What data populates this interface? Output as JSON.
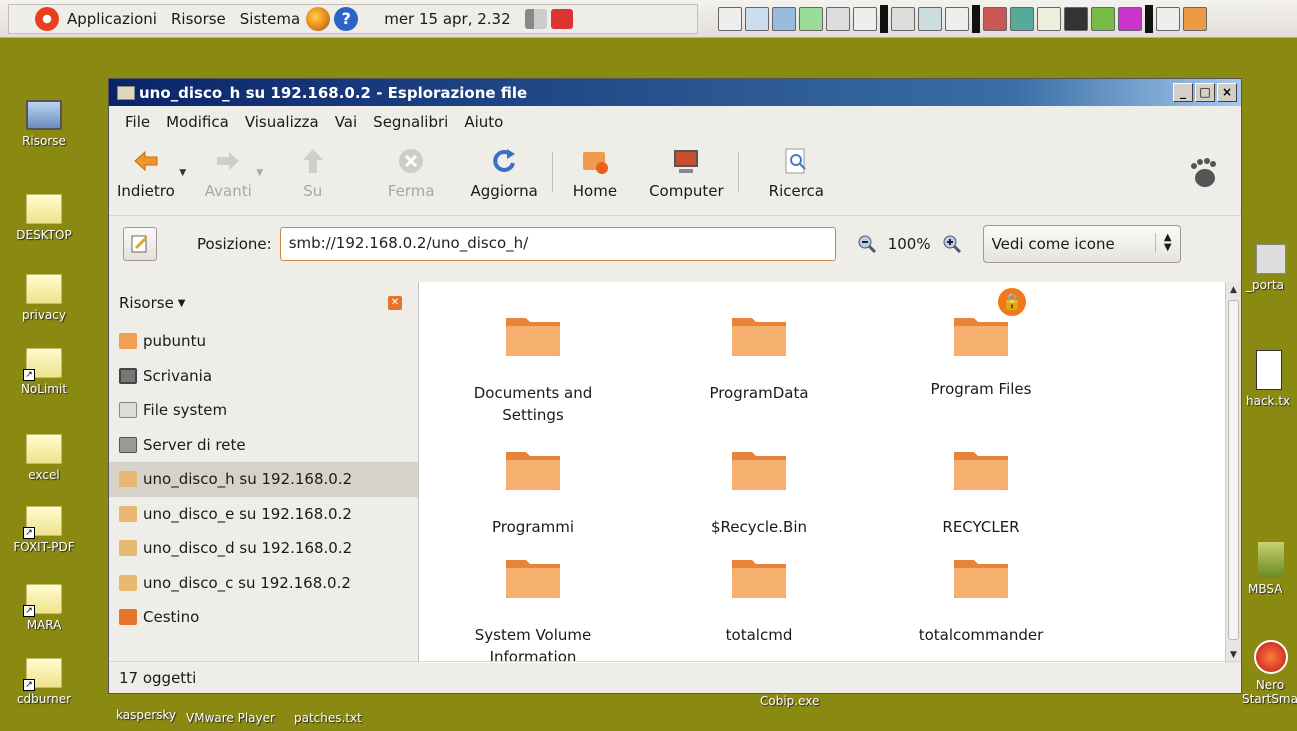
{
  "top_panel": {
    "menus": [
      "Applicazioni",
      "Risorse",
      "Sistema"
    ],
    "clock": "mer 15 apr,  2.32"
  },
  "desktop_left": [
    {
      "label": "Risorse",
      "icon": "computer-icon"
    },
    {
      "label": "DESKTOP",
      "icon": "folder-icon"
    },
    {
      "label": "privacy",
      "icon": "folder-icon"
    },
    {
      "label": "NoLimit",
      "icon": "folder-icon"
    },
    {
      "label": "excel",
      "icon": "folder-icon"
    },
    {
      "label": "FOXIT-PDF",
      "icon": "folder-icon"
    },
    {
      "label": "MARA",
      "icon": "folder-icon"
    },
    {
      "label": "cdburner",
      "icon": "folder-icon"
    }
  ],
  "desktop_right": [
    {
      "label": "_porta"
    },
    {
      "label": "hack.tx"
    },
    {
      "label": "MBSA"
    },
    {
      "label": "Nero StartSma"
    }
  ],
  "desktop_bottom": [
    "kaspersky",
    "VMware Player",
    "patches.txt",
    "Cobip.exe"
  ],
  "window": {
    "title": "uno_disco_h su 192.168.0.2 - Esplorazione file",
    "menu": [
      "File",
      "Modifica",
      "Visualizza",
      "Vai",
      "Segnalibri",
      "Aiuto"
    ],
    "toolbar": {
      "back": "Indietro",
      "forward": "Avanti",
      "up": "Su",
      "stop": "Ferma",
      "reload": "Aggiorna",
      "home": "Home",
      "computer": "Computer",
      "search": "Ricerca"
    },
    "location": {
      "label": "Posizione:",
      "value": "smb://192.168.0.2/uno_disco_h/",
      "zoom": "100%",
      "view_mode": "Vedi come icone"
    },
    "sidepane": {
      "title": "Risorse",
      "places": [
        {
          "label": "pubuntu",
          "icon": "home-folder-icon"
        },
        {
          "label": "Scrivania",
          "icon": "desktop-icon"
        },
        {
          "label": "File system",
          "icon": "drive-icon"
        },
        {
          "label": "Server di rete",
          "icon": "network-icon"
        },
        {
          "label": "uno_disco_h su 192.168.0.2",
          "icon": "network-share-icon",
          "selected": true
        },
        {
          "label": "uno_disco_e su 192.168.0.2",
          "icon": "network-share-icon"
        },
        {
          "label": "uno_disco_d su 192.168.0.2",
          "icon": "network-share-icon"
        },
        {
          "label": "uno_disco_c su 192.168.0.2",
          "icon": "network-share-icon"
        },
        {
          "label": "Cestino",
          "icon": "trash-icon"
        }
      ]
    },
    "folders": [
      {
        "name": "Documents and\nSettings"
      },
      {
        "name": "ProgramData"
      },
      {
        "name": "Program Files",
        "locked": true
      },
      {
        "name": "Programmi"
      },
      {
        "name": "$Recycle.Bin"
      },
      {
        "name": "RECYCLER"
      },
      {
        "name": "System Volume\nInformation"
      },
      {
        "name": "totalcmd"
      },
      {
        "name": "totalcommander"
      }
    ],
    "status": "17 oggetti"
  },
  "colors": {
    "desktop": "#8a8a12",
    "titlebar": "#0a246a",
    "folder_orange": "#f09a4a",
    "accent": "#e8732a"
  }
}
